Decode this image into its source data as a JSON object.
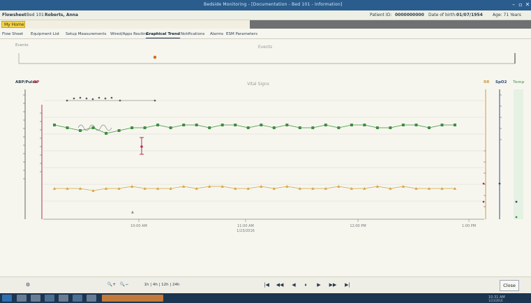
{
  "window": {
    "title": "Bedside Monitoring - [Documentation - Bed 101 - Information]",
    "min_icon": "–",
    "max_icon": "▫",
    "close_icon": "✕"
  },
  "header": {
    "app": "Flowsheet",
    "bed": "Bed 101",
    "patient": "Roberts, Anna",
    "id_label": "Patient ID:",
    "id_value": "0000000000",
    "dob_label": "Date of birth:",
    "dob_value": "01/07/1954",
    "sex": "Age: 71 Years"
  },
  "menu": {
    "home": "My Home"
  },
  "tabs": [
    "Flow Sheet",
    "Equipment List",
    "Setup Measurements",
    "Wired/Apps Routine",
    "Graphical Trend",
    "Notifications",
    "Alarms",
    "ESM Parameters"
  ],
  "active_tab_index": 4,
  "events": {
    "title": "Events",
    "left_label": "Events"
  },
  "vitals": {
    "title": "Vital Signs",
    "left_axes": [
      "ABP/Pulse",
      "BP"
    ],
    "right_axes": [
      "RR",
      "SpO2",
      "Temp"
    ],
    "x_ticks": [
      "10:00 AM",
      "11:00 AM",
      "12:00 PM",
      "1:00 PM"
    ],
    "x_date": "1/23/2016"
  },
  "chart_data": {
    "type": "line",
    "title": "Vital Signs",
    "x_ticks": [
      "10:00 AM",
      "11:00 AM",
      "12:00 PM",
      "1:00 PM"
    ],
    "series": [
      {
        "name": "SpO2",
        "color": "#3f8f3f",
        "values": [
          97,
          96,
          95,
          96,
          94,
          95,
          96,
          96,
          97,
          96,
          97,
          97,
          96,
          97,
          97,
          96,
          97,
          96,
          97,
          96,
          96,
          97,
          96,
          97,
          97,
          96,
          96,
          97,
          97,
          96,
          97,
          97
        ]
      },
      {
        "name": "RR",
        "color": "#d8a23e",
        "values": [
          18,
          18,
          18,
          17,
          18,
          18,
          19,
          18,
          18,
          18,
          19,
          18,
          19,
          19,
          18,
          18,
          19,
          18,
          19,
          18,
          18,
          18,
          19,
          18,
          18,
          19,
          18,
          19,
          18,
          18,
          18,
          18
        ]
      }
    ]
  },
  "toolbar": {
    "settings_icon": "⚙",
    "zoom_in_icon": "🔍+",
    "zoom_out_icon": "🔍−",
    "range": "1h | 4h | 12h | 24h",
    "first": "|◀",
    "prev_page": "◀◀",
    "prev": "◀",
    "pause": "⏸",
    "next": "▶",
    "next_page": "▶▶",
    "last": "▶|",
    "close": "Close"
  },
  "taskbar": {
    "time": "10:31 AM",
    "date": "1/23/2016"
  }
}
